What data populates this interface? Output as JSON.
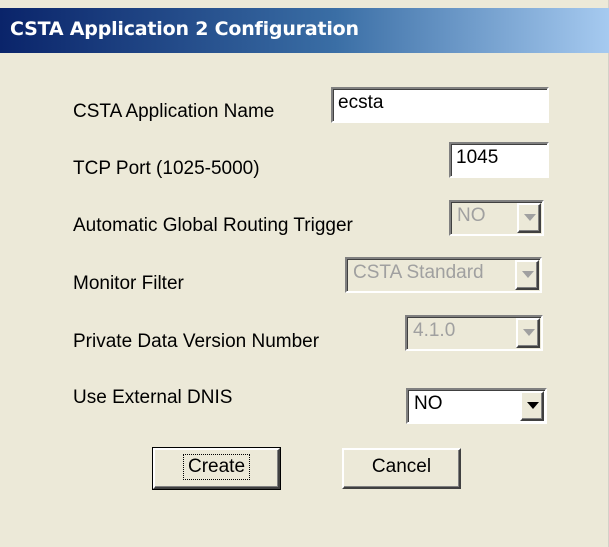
{
  "window": {
    "title": "CSTA Application 2 Configuration"
  },
  "form": {
    "app_name": {
      "label": "CSTA Application Name",
      "value": "ecsta"
    },
    "tcp_port": {
      "label": "TCP Port (1025-5000)",
      "value": "1045"
    },
    "global_routing": {
      "label": "Automatic Global Routing Trigger",
      "value": "NO",
      "enabled": false
    },
    "monitor_filter": {
      "label": "Monitor Filter",
      "value": "CSTA Standard",
      "enabled": false
    },
    "private_data_version": {
      "label": "Private Data Version Number",
      "value": "4.1.0",
      "enabled": false
    },
    "external_dnis": {
      "label": "Use External DNIS",
      "value": "NO",
      "enabled": true
    }
  },
  "buttons": {
    "create": "Create",
    "cancel": "Cancel"
  },
  "colors": {
    "title_bar_start": "#0a246a",
    "title_bar_end": "#a6caf0",
    "dialog_background": "#ece9d8",
    "disabled_text": "#a0a0a0"
  }
}
